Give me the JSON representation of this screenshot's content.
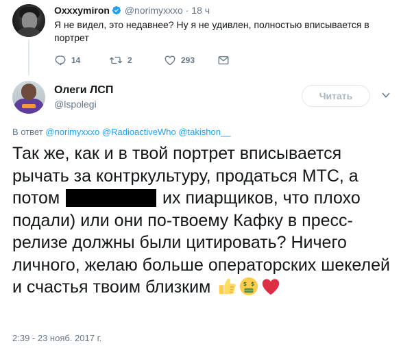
{
  "parent_tweet": {
    "name": "Oxxxymiron",
    "handle": "@norimyxxxo",
    "separator": "·",
    "time": "18 ч",
    "text": "Я не видел, это недавнее? Ну я не удивлен, полностью вписывается в портрет",
    "reply_count": "14",
    "retweet_count": "2",
    "like_count": "293"
  },
  "main_tweet": {
    "name": "Олеги ЛСП",
    "handle": "@lspolegi",
    "follow_label": "Читать",
    "reply_prefix": "В ответ ",
    "reply_to": [
      "@norimyxxxo",
      "@RadioactiveWho",
      "@takishon__"
    ],
    "text_before_redaction": "Так же, как и в твой портрет вписывается рычать за контркультуру, продаться МТС, а потом ",
    "text_after_redaction": " их пиарщиков, что плохо подали) или они по-твоему Кафку в пресс-релизе должны были цитировать? Ничего личного, желаю больше операторских шекелей и счастья твоим близким ",
    "emojis": [
      "thumbs-up",
      "money-mouth-face",
      "red-heart"
    ],
    "timestamp": "2:39 - 23 нояб. 2017 г."
  },
  "colors": {
    "link": "#1da1f2",
    "secondary_text": "#657786",
    "verified": "#1da1f2",
    "redaction": "#000000"
  }
}
